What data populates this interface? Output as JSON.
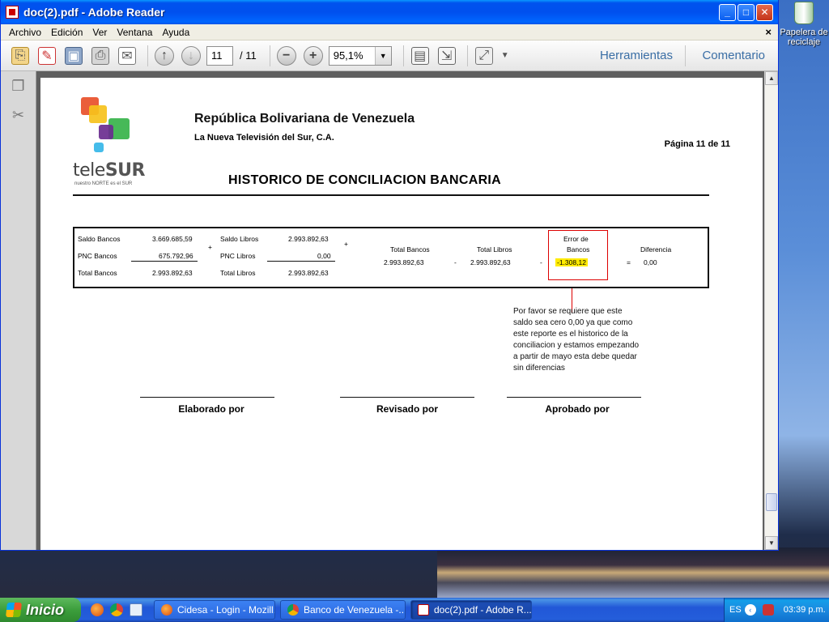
{
  "window": {
    "title": "doc(2).pdf - Adobe Reader"
  },
  "desktop": {
    "recycle_label": "Papelera de reciclaje"
  },
  "menu": [
    "Archivo",
    "Edición",
    "Ver",
    "Ventana",
    "Ayuda"
  ],
  "toolbar": {
    "page_current": "11",
    "page_total": "/ 11",
    "zoom": "95,1%",
    "tools_label": "Herramientas",
    "comment_label": "Comentario"
  },
  "doc": {
    "logo_text_a": "tele",
    "logo_text_b": "SUR",
    "logo_tagline": "nuestro NORTE es el SUR",
    "title": "República Bolivariana de Venezuela",
    "company": "La Nueva Televisión del Sur, C.A.",
    "page_label": "Página 11 de 11",
    "heading": "HISTORICO DE CONCILIACION BANCARIA",
    "recon": {
      "saldo_bancos_label": "Saldo Bancos",
      "saldo_bancos": "3.669.685,59",
      "pnc_bancos_label": "PNC Bancos",
      "pnc_bancos": "675.792,96",
      "total_bancos_label": "Total Bancos",
      "total_bancos": "2.993.892,63",
      "plus1": "+",
      "saldo_libros_label": "Saldo Libros",
      "saldo_libros": "2.993.892,63",
      "pnc_libros_label": "PNC Libros",
      "pnc_libros": "0,00",
      "total_libros_label": "Total Libros",
      "total_libros": "2.993.892,63",
      "plus2": "+",
      "col_total_bancos": "Total Bancos",
      "col_total_bancos_val": "2.993.892,63",
      "minus1": "-",
      "col_total_libros": "Total Libros",
      "col_total_libros_val": "2.993.892,63",
      "minus2": "-",
      "col_error_1": "Error de",
      "col_error_2": "Bancos",
      "col_error_val": "-1.308,12",
      "equals": "=",
      "col_diferencia": "Diferencia",
      "col_diferencia_val": "0,00"
    },
    "note": "Por favor se requiere que este saldo sea cero 0,00 ya que como este reporte es el historico de la conciliacion y estamos empezando a partir de mayo esta debe quedar sin diferencias",
    "signatures": [
      "Elaborado por",
      "Revisado por",
      "Aprobado por"
    ]
  },
  "taskbar": {
    "start": "Inicio",
    "tasks": [
      "Cidesa - Login - Mozill...",
      "Banco de Venezuela -...",
      "doc(2).pdf - Adobe R..."
    ],
    "lang": "ES",
    "clock": "03:39 p.m."
  },
  "colors": {
    "titlebar": "#0053ee",
    "highlight": "#ffeb00",
    "error_border": "#dd0000",
    "link": "#3a6ea5"
  }
}
